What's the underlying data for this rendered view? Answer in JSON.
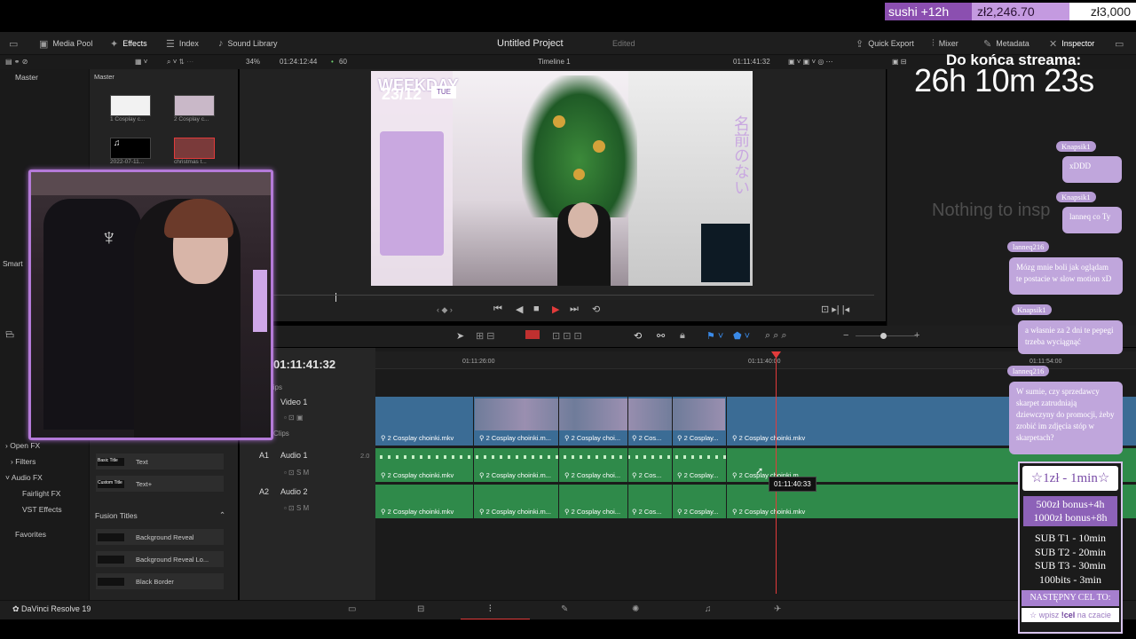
{
  "donation": {
    "name": "sushi +12h",
    "amount": "zł2,246.70",
    "goal": "zł3,000"
  },
  "topbar": {
    "media_pool": "Media Pool",
    "effects": "Effects",
    "index": "Index",
    "sound_library": "Sound Library",
    "project_title": "Untitled Project",
    "edited": "Edited",
    "quick_export": "Quick Export",
    "mixer": "Mixer",
    "metadata": "Metadata",
    "inspector": "Inspector"
  },
  "toolbar2": {
    "zoom": "34%",
    "duration": "01:24:12:44",
    "fps": "60",
    "timeline_name": "Timeline 1",
    "timecode": "01:11:41:32"
  },
  "left_panel": {
    "master": "Master",
    "smart": "Smart",
    "items": [
      "Open FX",
      "Filters",
      "Audio FX",
      "Fairlight FX",
      "VST Effects",
      "Favorites"
    ]
  },
  "media": {
    "master": "Master",
    "thumbs": [
      "1 Cosplay c...",
      "2 Cosplay c...",
      "2022-07-11...",
      "christmas t..."
    ],
    "titles": [
      "Basic Title",
      "Custom Title"
    ],
    "title_items": [
      "Text",
      "Text+"
    ],
    "fusion_header": "Fusion Titles",
    "fusion_items": [
      "Background Reveal",
      "Background Reveal Lo...",
      "Black Border"
    ]
  },
  "inspector": {
    "empty": "Nothing to insp"
  },
  "timeline": {
    "timecode": "01:11:41:32",
    "ruler": [
      "01:11:26:00",
      "01:11:40:00",
      "01:11:54:00"
    ],
    "tracks": {
      "v1": "Video 1",
      "a1": "A1",
      "a1_name": "Audio 1",
      "a1_level": "2.0",
      "a2": "A2",
      "a2_name": "Audio 2",
      "clips_label": "Clips",
      "lips": "lips"
    },
    "clip_name": "2 Cosplay choinki.mkv",
    "clip_short1": "2 Cosplay choinki.m...",
    "clip_short2": "2 Cosplay choi...",
    "clip_short3": "2 Cos...",
    "clip_short4": "2 Cosplay...",
    "clip_partial": "2 Cosplay choinki.m",
    "tooltip": "01:11:40:33"
  },
  "app_name": "DaVinci Resolve 19",
  "stream": {
    "countdown_label": "Do końca streama:",
    "countdown": "26h 10m 23s"
  },
  "video_overlay": {
    "weekday": "WEEKDAY",
    "date": "23/12",
    "day": "TUE"
  },
  "chat": [
    {
      "user": "Knapsik1",
      "text": "xDDD"
    },
    {
      "user": "Knapsik1",
      "text": "lanneq co Ty"
    },
    {
      "user": "lanneq216",
      "text": "Mózg mnie boli jak oglądam te postacie w slow motion xD"
    },
    {
      "user": "Knapsik1",
      "text": "a własnie za 2 dni te pepegi trzeba wyciągnąć"
    },
    {
      "user": "lanneq216",
      "text": "W sumie, czy sprzedawcy skarpet zatrudniają dziewczyny do promocji, żeby zrobić im zdjęcia stóp w skarpetach?"
    }
  ],
  "subs": {
    "top": "☆1zł - 1min☆",
    "bonus": [
      "500zł bonus+4h",
      "1000zł bonus+8h"
    ],
    "tiers": [
      "SUB T1 - 10min",
      "SUB T2 - 20min",
      "SUB T3 - 30min",
      "100bits - 3min"
    ],
    "next": "NASTĘPNY CEL TO:",
    "cmd_prefix": "☆ wpisz",
    "cmd": "!cel",
    "cmd_suffix": "na czacie"
  },
  "colors": {
    "accent": "#b47ad8",
    "playhead": "#e23b3b",
    "video": "#3b6c95",
    "audio": "#2f8a4a"
  }
}
